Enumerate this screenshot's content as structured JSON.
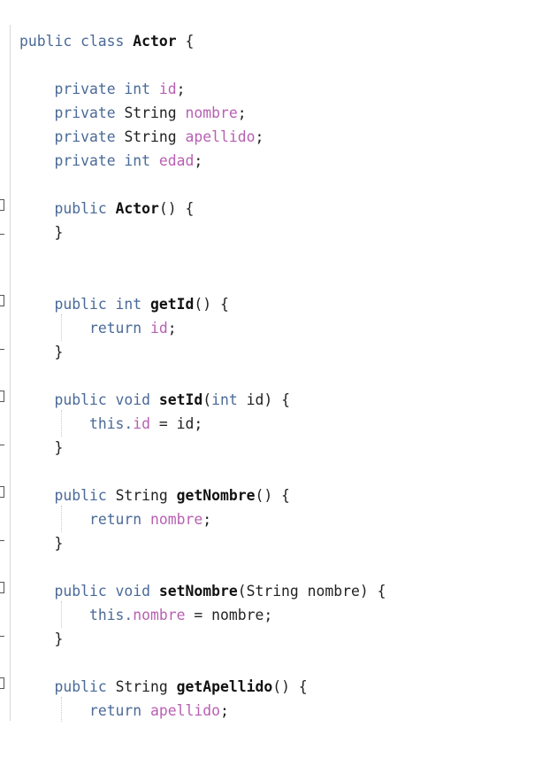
{
  "code": {
    "lines": [
      [
        {
          "t": "public class ",
          "c": "kw"
        },
        {
          "t": "Actor",
          "c": "nm"
        },
        {
          "t": " {",
          "c": "p"
        }
      ],
      [],
      [
        {
          "t": "    "
        },
        {
          "t": "private int ",
          "c": "kw"
        },
        {
          "t": "id",
          "c": "fld"
        },
        {
          "t": ";",
          "c": "p"
        }
      ],
      [
        {
          "t": "    "
        },
        {
          "t": "private ",
          "c": "kw"
        },
        {
          "t": "String ",
          "c": "pl"
        },
        {
          "t": "nombre",
          "c": "fld"
        },
        {
          "t": ";",
          "c": "p"
        }
      ],
      [
        {
          "t": "    "
        },
        {
          "t": "private ",
          "c": "kw"
        },
        {
          "t": "String ",
          "c": "pl"
        },
        {
          "t": "apellido",
          "c": "fld"
        },
        {
          "t": ";",
          "c": "p"
        }
      ],
      [
        {
          "t": "    "
        },
        {
          "t": "private int ",
          "c": "kw"
        },
        {
          "t": "edad",
          "c": "fld"
        },
        {
          "t": ";",
          "c": "p"
        }
      ],
      [],
      [
        {
          "t": "    "
        },
        {
          "t": "public ",
          "c": "kw"
        },
        {
          "t": "Actor",
          "c": "nm"
        },
        {
          "t": "() {",
          "c": "p"
        }
      ],
      [
        {
          "t": "    "
        },
        {
          "t": "}",
          "c": "p"
        }
      ],
      [],
      [],
      [
        {
          "t": "    "
        },
        {
          "t": "public int ",
          "c": "kw"
        },
        {
          "t": "getId",
          "c": "nm"
        },
        {
          "t": "() {",
          "c": "p"
        }
      ],
      [
        {
          "t": "        "
        },
        {
          "t": "return ",
          "c": "kw"
        },
        {
          "t": "id",
          "c": "fld"
        },
        {
          "t": ";",
          "c": "p"
        }
      ],
      [
        {
          "t": "    "
        },
        {
          "t": "}",
          "c": "p"
        }
      ],
      [],
      [
        {
          "t": "    "
        },
        {
          "t": "public void ",
          "c": "kw"
        },
        {
          "t": "setId",
          "c": "nm"
        },
        {
          "t": "(",
          "c": "p"
        },
        {
          "t": "int ",
          "c": "kw"
        },
        {
          "t": "id) {",
          "c": "pl"
        }
      ],
      [
        {
          "t": "        "
        },
        {
          "t": "this.",
          "c": "kw"
        },
        {
          "t": "id",
          "c": "fld"
        },
        {
          "t": " = id;",
          "c": "pl"
        }
      ],
      [
        {
          "t": "    "
        },
        {
          "t": "}",
          "c": "p"
        }
      ],
      [],
      [
        {
          "t": "    "
        },
        {
          "t": "public ",
          "c": "kw"
        },
        {
          "t": "String ",
          "c": "pl"
        },
        {
          "t": "getNombre",
          "c": "nm"
        },
        {
          "t": "() {",
          "c": "p"
        }
      ],
      [
        {
          "t": "        "
        },
        {
          "t": "return ",
          "c": "kw"
        },
        {
          "t": "nombre",
          "c": "fld"
        },
        {
          "t": ";",
          "c": "p"
        }
      ],
      [
        {
          "t": "    "
        },
        {
          "t": "}",
          "c": "p"
        }
      ],
      [],
      [
        {
          "t": "    "
        },
        {
          "t": "public void ",
          "c": "kw"
        },
        {
          "t": "setNombre",
          "c": "nm"
        },
        {
          "t": "(String nombre) {",
          "c": "pl"
        }
      ],
      [
        {
          "t": "        "
        },
        {
          "t": "this.",
          "c": "kw"
        },
        {
          "t": "nombre",
          "c": "fld"
        },
        {
          "t": " = nombre;",
          "c": "pl"
        }
      ],
      [
        {
          "t": "    "
        },
        {
          "t": "}",
          "c": "p"
        }
      ],
      [],
      [
        {
          "t": "    "
        },
        {
          "t": "public ",
          "c": "kw"
        },
        {
          "t": "String ",
          "c": "pl"
        },
        {
          "t": "getApellido",
          "c": "nm"
        },
        {
          "t": "() {",
          "c": "p"
        }
      ],
      [
        {
          "t": "        "
        },
        {
          "t": "return ",
          "c": "kw"
        },
        {
          "t": "apellido",
          "c": "fld"
        },
        {
          "t": ";",
          "c": "p"
        }
      ]
    ]
  },
  "colors": {
    "keyword": "#4a6a98",
    "field": "#b85fb3",
    "name": "#111111",
    "plain": "#222222",
    "background": "#ffffff"
  }
}
